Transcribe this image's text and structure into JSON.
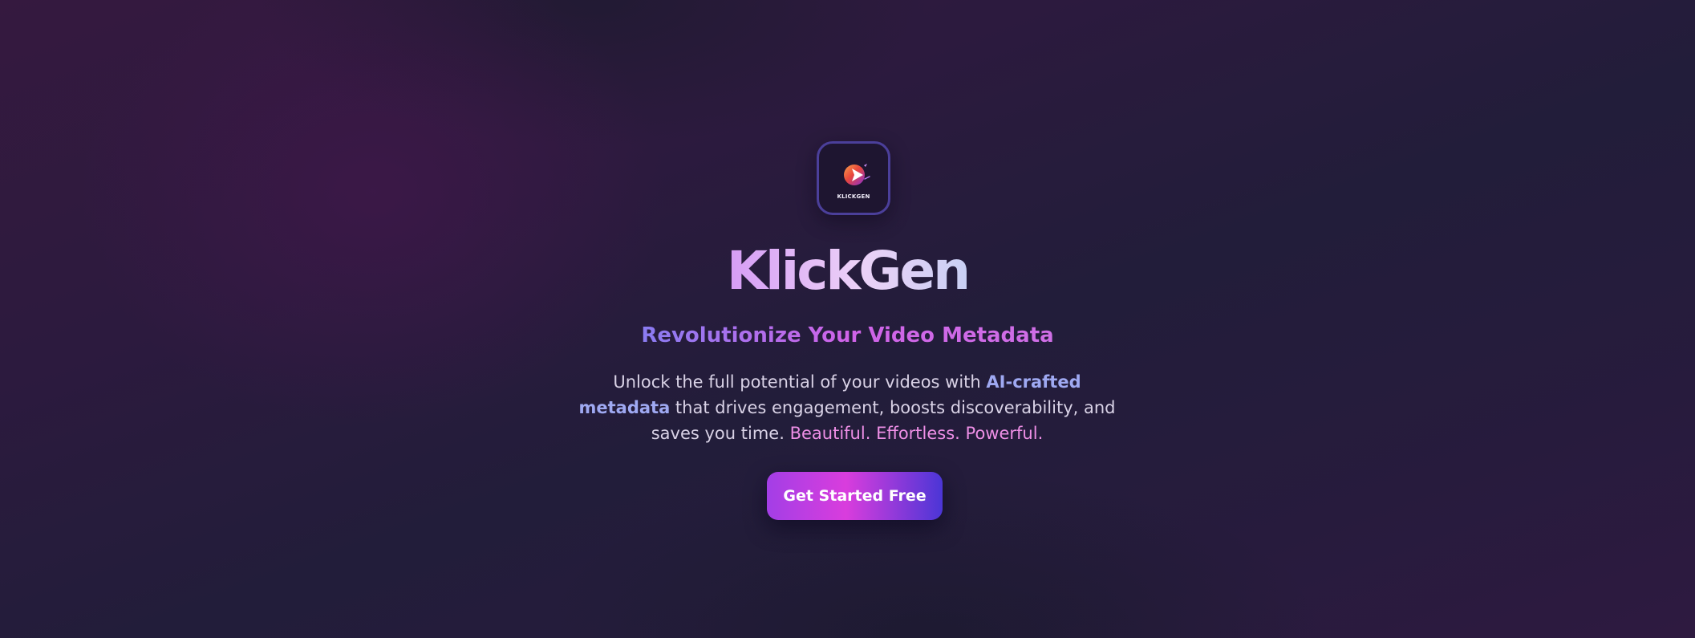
{
  "logo": {
    "wordmark": "KLICKGEN",
    "icon": "klickgen-logo-icon"
  },
  "hero": {
    "title": "KlickGen",
    "tagline": "Revolutionize Your Video Metadata",
    "description": {
      "part1": "Unlock the full potential of your videos with ",
      "highlight": "AI-crafted metadata",
      "part2": " that drives engagement, boosts discoverability, and saves you time. ",
      "word1": "Beautiful",
      "word2": "Effortless",
      "word3": "Powerful"
    },
    "cta_label": "Get Started Free"
  },
  "colors": {
    "background": "#2a1b3e",
    "title_gradient_start": "#d59cf5",
    "title_gradient_end": "#c9d0f4",
    "tagline_gradient_start": "#8a7cf2",
    "tagline_gradient_end": "#cf6fe6",
    "highlight_blue": "#9fa9f2",
    "highlight_pink": "#ee8fe6",
    "cta_gradient_start": "#a33ee6",
    "cta_gradient_mid": "#d93ddd",
    "cta_gradient_end": "#4b36d6"
  }
}
